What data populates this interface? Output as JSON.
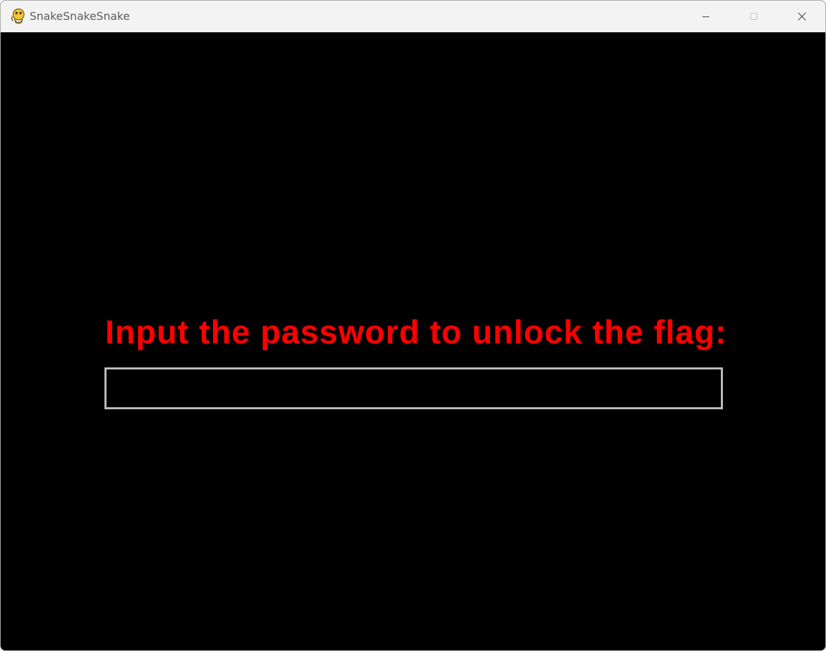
{
  "window": {
    "title": "SnakeSnakeSnake",
    "icon": "pygame-snake-icon",
    "controls": [
      "minimize-icon",
      "maximize-icon",
      "close-icon"
    ]
  },
  "game": {
    "prompt": "Input the password to unlock the flag:",
    "password_value": "",
    "colors": {
      "background": "#000000",
      "prompt": "#ff0000",
      "input_border": "#bdbdbd"
    }
  }
}
